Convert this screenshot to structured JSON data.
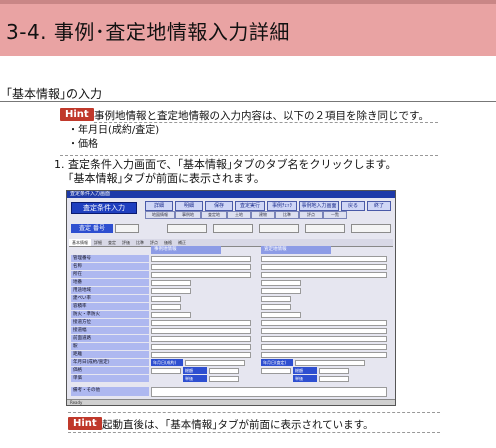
{
  "page": {
    "title": "3-4. 事例･査定地情報入力詳細",
    "section_heading": "｢基本情報｣の入力"
  },
  "hint1": {
    "badge": "Hint",
    "text": "事例地情報と査定地情報の入力内容は、以下の２項目を除き同じです。",
    "bullets": [
      "・年月日(成約/査定)",
      "・価格"
    ]
  },
  "step1": {
    "number": "1.",
    "text": "査定条件入力画面で、｢基本情報｣タブのタブ名をクリックします。",
    "subtext": "｢基本情報｣タブが前面に表示されます。"
  },
  "screenshot": {
    "window_title": "査定条件入力画面",
    "mode_label": "査定条件入力",
    "toolbar_buttons": [
      "詳細",
      "明細",
      "保存",
      "査定実行",
      "事例ﾁｪｯｸ",
      "事例地入力画面",
      "戻る",
      "終了"
    ],
    "sub_buttons": [
      "地図情報",
      "事例地",
      "査定地",
      "土地",
      "建物",
      "比準",
      "評点",
      "一覧"
    ],
    "header_label": "査定 番号",
    "tabs": [
      "基本情報",
      "詳細",
      "査定",
      "評価",
      "比準",
      "評点",
      "価格",
      "補正"
    ],
    "left_column_title": "事例地情報",
    "right_column_title": "査定地情報",
    "row_labels": [
      "管理番号",
      "名称",
      "所在",
      "地番",
      "用途地域",
      "建ぺい率",
      "容積率",
      "防火・準防火",
      "接道方位",
      "接道幅",
      "前面道路",
      "駅",
      "距離",
      "年月日(成約/査定)",
      "価格",
      "単価",
      "備考・その他"
    ],
    "date_field_label": "年月日(成約)",
    "date_field_label_right": "年月日(査定)",
    "price_labels": [
      "総額",
      "単価"
    ],
    "status_bar": "Ready"
  },
  "hint2": {
    "badge": "Hint",
    "text": "起動直後は、｢基本情報｣タブが前面に表示されています。"
  },
  "colors": {
    "title_band": "#e9a3a3",
    "hint_badge": "#c0392b",
    "app_title_bar": "#1e3aa8"
  }
}
